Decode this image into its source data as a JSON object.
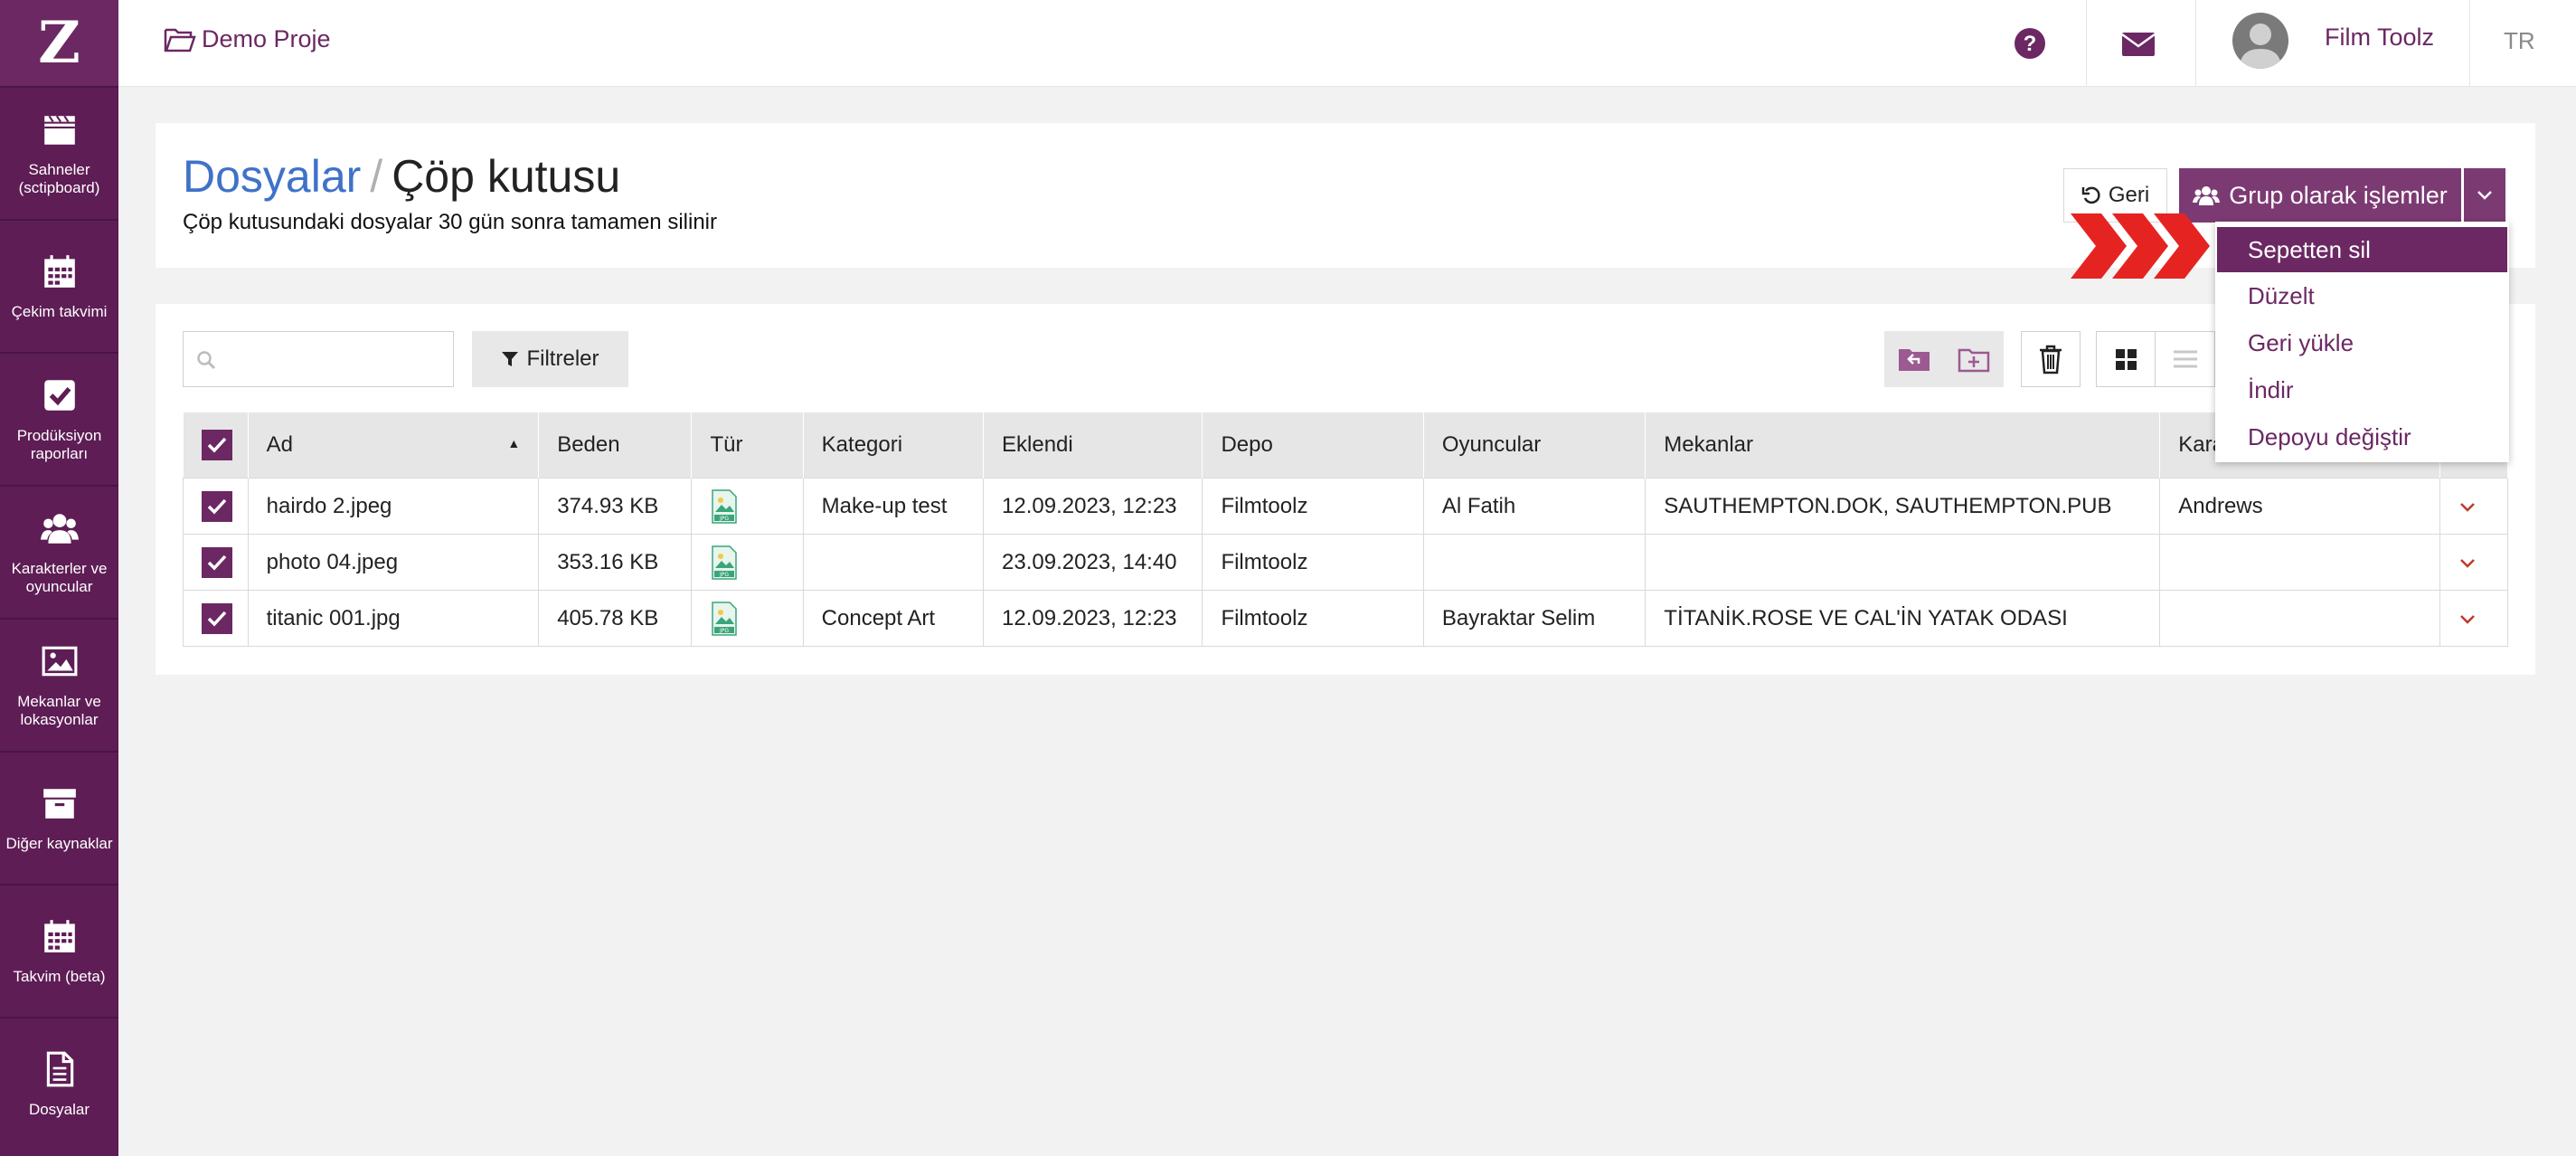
{
  "app": {
    "logo_text": "Z"
  },
  "sidebar": {
    "items": [
      {
        "label": "Sahneler (sctipboard)",
        "icon": "clapperboard-icon"
      },
      {
        "label": "Çekim takvimi",
        "icon": "calendar-icon"
      },
      {
        "label": "Prodüksiyon raporları",
        "icon": "checkbox-icon"
      },
      {
        "label": "Karakterler ve oyuncular",
        "icon": "users-icon"
      },
      {
        "label": "Mekanlar ve lokasyonlar",
        "icon": "image-icon"
      },
      {
        "label": "Diğer kaynaklar",
        "icon": "archive-icon"
      },
      {
        "label": "Takvim (beta)",
        "icon": "calendar-icon"
      },
      {
        "label": "Dosyalar",
        "icon": "file-icon"
      }
    ]
  },
  "topbar": {
    "project": "Demo Proje",
    "user": "Film Toolz",
    "lang": "TR"
  },
  "header": {
    "breadcrumb_parent": "Dosyalar",
    "breadcrumb_sep": "/",
    "title": "Çöp kutusu",
    "subtitle": "Çöp kutusundaki dosyalar 30 gün sonra tamamen silinir",
    "back_label": "Geri",
    "group_label": "Grup olarak işlemler"
  },
  "dropdown": {
    "items": [
      "Sepetten sil",
      "Düzelt",
      "Geri yükle",
      "İndir",
      "Depoyu değiştir"
    ]
  },
  "toolbar": {
    "search_placeholder": "",
    "filter_label": "Filtreler"
  },
  "table": {
    "columns": [
      "Ad",
      "Beden",
      "Tür",
      "Kategori",
      "Eklendi",
      "Depo",
      "Oyuncular",
      "Mekanlar",
      "Kara"
    ],
    "rows": [
      {
        "name": "hairdo 2.jpeg",
        "size": "374.93 KB",
        "category": "Make-up test",
        "added": "12.09.2023, 12:23",
        "depot": "Filmtoolz",
        "actors": "Al Fatih",
        "locations": "SAUTHEMPTON.DOK, SAUTHEMPTON.PUB",
        "chars": "Andrews"
      },
      {
        "name": "photo 04.jpeg",
        "size": "353.16 KB",
        "category": "",
        "added": "23.09.2023, 14:40",
        "depot": "Filmtoolz",
        "actors": "",
        "locations": "",
        "chars": ""
      },
      {
        "name": "titanic 001.jpg",
        "size": "405.78 KB",
        "category": "Concept Art",
        "added": "12.09.2023, 12:23",
        "depot": "Filmtoolz",
        "actors": "Bayraktar Selim",
        "locations": "TİTANİK.ROSE VE CAL'İN YATAK ODASI",
        "chars": ""
      }
    ]
  },
  "colors": {
    "brand": "#6b2863",
    "sidebar": "#5e1d55",
    "link": "#3f72c8",
    "arrow": "#e52421"
  }
}
